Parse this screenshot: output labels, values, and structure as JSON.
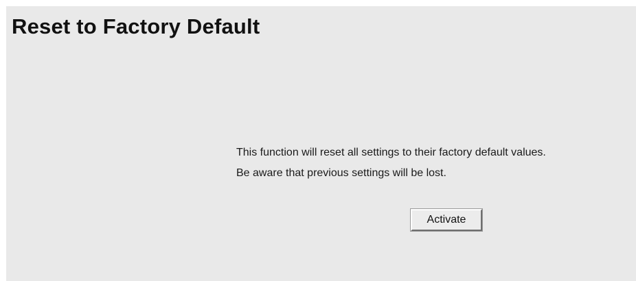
{
  "page": {
    "title": "Reset to Factory Default"
  },
  "message": {
    "line1": "This function will reset all settings to their factory default values.",
    "line2": "Be aware that previous settings will be lost."
  },
  "actions": {
    "activate_label": "Activate"
  },
  "colors": {
    "panel_background": "#e9e9e9",
    "page_background": "#ffffff",
    "text": "#111111"
  }
}
